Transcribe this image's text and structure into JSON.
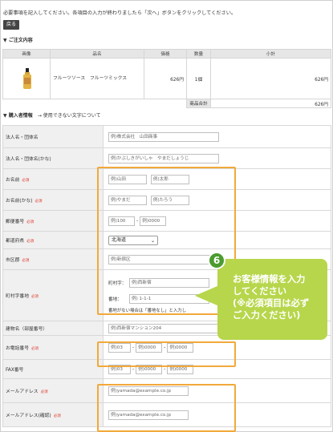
{
  "instruction": "必要事項を記入してください。各項目の入力が終わりましたら「次へ」ボタンをクリックしてください。",
  "back_button": "戻る",
  "order_section": {
    "title": "▼ ご注文内容",
    "headers": [
      "画像",
      "品名",
      "価格",
      "数量",
      "小計"
    ],
    "rows": [
      {
        "name": "フルーツソース　フルーツミックス",
        "price": "626円",
        "qty": "1個",
        "subtotal": "626円"
      }
    ],
    "total_label": "商品合計",
    "total_value": "626円"
  },
  "buyer_section": {
    "title": "▼ 購入者情報",
    "link": "→ 使用できない文字について"
  },
  "form": {
    "required_mark": "必須",
    "company": {
      "label": "法人名・団体名",
      "placeholder": "例)株式会社　山田商事"
    },
    "company_kana": {
      "label": "法人名・団体名(かな)",
      "placeholder": "例)かぶしきがいしゃ　やまだしょうじ"
    },
    "name": {
      "label": "お名前",
      "last": "例)山田",
      "first": "例)太郎"
    },
    "name_kana": {
      "label": "お名前(かな)",
      "last": "例)やまだ",
      "first": "例)たろう"
    },
    "zip": {
      "label": "郵便番号",
      "part1": "例)100",
      "sep": "-",
      "part2": "例)0000"
    },
    "pref": {
      "label": "都道府県",
      "value": "北海道"
    },
    "city": {
      "label": "市区郡",
      "placeholder": "例)新宿区"
    },
    "town": {
      "label": "町村字番地",
      "town_label": "町村字：",
      "town_placeholder": "例)西新宿",
      "banchi_label": "番地：",
      "banchi_placeholder": "例) 1-1-1",
      "note": "番地がない場合は「番地なし」と入力し"
    },
    "building": {
      "label": "建物名（部屋番号）",
      "placeholder": "例)西新宿マンション204"
    },
    "phone": {
      "label": "お電話番号",
      "p1": "例)03",
      "p2": "例)0000",
      "p3": "例)0000",
      "sep": "-"
    },
    "fax": {
      "label": "FAX番号",
      "p1": "例)03",
      "p2": "例)0000",
      "p3": "例)0000",
      "sep": "-"
    },
    "email": {
      "label": "メールアドレス",
      "placeholder": "例)yamada@example.co.jp"
    },
    "email_confirm": {
      "label": "メールアドレス(確認)",
      "placeholder": "例)yamada@example.co.jp"
    }
  },
  "callout": {
    "number": "6",
    "lines": [
      "お客様情報を入力",
      "してください",
      "(※必須項目は必ず",
      "ご入力ください)"
    ]
  },
  "colors": {
    "highlight": "#f2a93b",
    "callout_bg": "#b7d64c",
    "callout_badge": "#4c9b2f",
    "required": "#e03a2e"
  }
}
